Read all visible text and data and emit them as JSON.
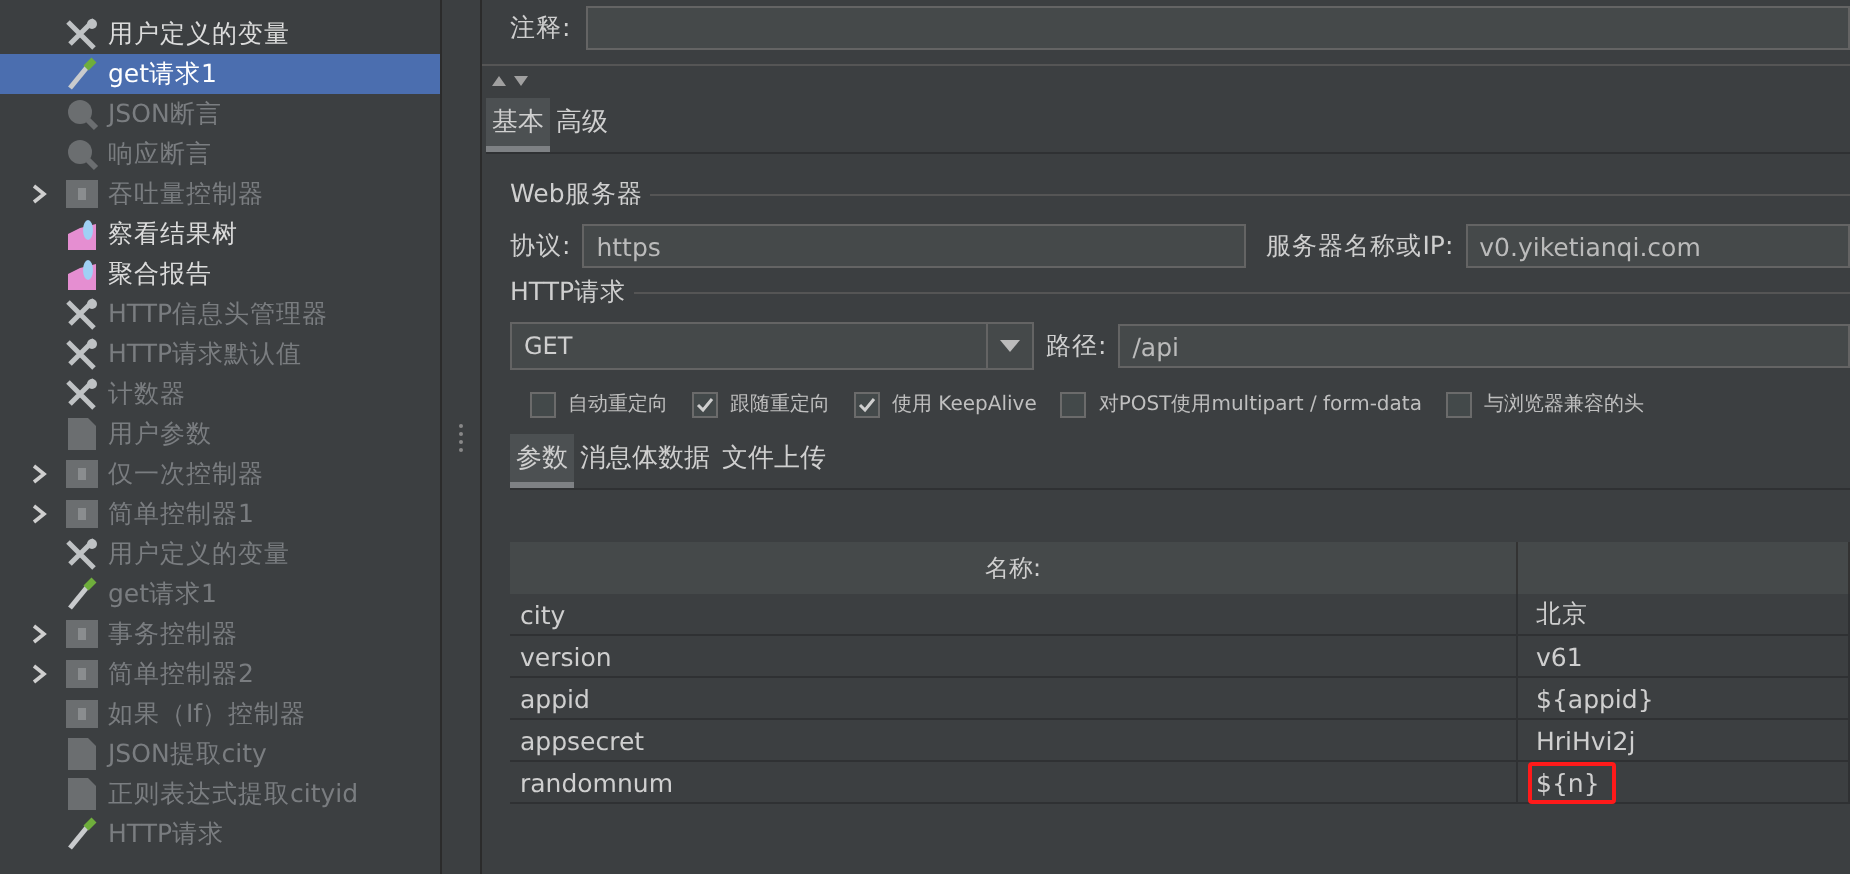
{
  "tree": {
    "items": [
      {
        "label": "用户定义的变量",
        "kind": "wrench",
        "has_children": false,
        "enabled": true,
        "selected": false
      },
      {
        "label": "get请求1",
        "kind": "pipette",
        "has_children": false,
        "enabled": true,
        "selected": true
      },
      {
        "label": "JSON断言",
        "kind": "magnifier",
        "has_children": false,
        "enabled": false,
        "selected": false
      },
      {
        "label": "响应断言",
        "kind": "magnifier",
        "has_children": false,
        "enabled": false,
        "selected": false
      },
      {
        "label": "吞吐量控制器",
        "kind": "controller",
        "has_children": true,
        "enabled": false,
        "selected": false
      },
      {
        "label": "察看结果树",
        "kind": "graph",
        "has_children": false,
        "enabled": true,
        "selected": false
      },
      {
        "label": "聚合报告",
        "kind": "graph",
        "has_children": false,
        "enabled": true,
        "selected": false
      },
      {
        "label": "HTTP信息头管理器",
        "kind": "wrench",
        "has_children": false,
        "enabled": false,
        "selected": false
      },
      {
        "label": "HTTP请求默认值",
        "kind": "wrench",
        "has_children": false,
        "enabled": false,
        "selected": false
      },
      {
        "label": "计数器",
        "kind": "wrench",
        "has_children": false,
        "enabled": false,
        "selected": false
      },
      {
        "label": "用户参数",
        "kind": "page",
        "has_children": false,
        "enabled": false,
        "selected": false
      },
      {
        "label": "仅一次控制器",
        "kind": "controller",
        "has_children": true,
        "enabled": false,
        "selected": false
      },
      {
        "label": "简单控制器1",
        "kind": "controller",
        "has_children": true,
        "enabled": false,
        "selected": false
      },
      {
        "label": "用户定义的变量",
        "kind": "wrench",
        "has_children": false,
        "enabled": false,
        "selected": false
      },
      {
        "label": "get请求1",
        "kind": "pipette",
        "has_children": false,
        "enabled": false,
        "selected": false
      },
      {
        "label": "事务控制器",
        "kind": "controller",
        "has_children": true,
        "enabled": false,
        "selected": false
      },
      {
        "label": "简单控制器2",
        "kind": "controller",
        "has_children": true,
        "enabled": false,
        "selected": false
      },
      {
        "label": "如果（If）控制器",
        "kind": "controller",
        "has_children": false,
        "enabled": false,
        "selected": false
      },
      {
        "label": "JSON提取city",
        "kind": "page",
        "has_children": false,
        "enabled": false,
        "selected": false
      },
      {
        "label": "正则表达式提取cityid",
        "kind": "page",
        "has_children": false,
        "enabled": false,
        "selected": false
      },
      {
        "label": "HTTP请求",
        "kind": "pipette",
        "has_children": false,
        "enabled": false,
        "selected": false
      }
    ]
  },
  "comment": {
    "label": "注释:"
  },
  "tabs": [
    {
      "label": "基本",
      "selected": true
    },
    {
      "label": "高级",
      "selected": false
    }
  ],
  "web_server": {
    "title": "Web服务器",
    "protocol_label": "协议:",
    "protocol": "https",
    "server_label": "服务器名称或IP:",
    "server": "v0.yiketianqi.com"
  },
  "http_request": {
    "title": "HTTP请求",
    "method": "GET",
    "path_label": "路径:",
    "path": "/api",
    "options": [
      {
        "label": "自动重定向",
        "checked": false
      },
      {
        "label": "跟随重定向",
        "checked": true
      },
      {
        "label": "使用 KeepAlive",
        "checked": true
      },
      {
        "label": "对POST使用multipart / form-data",
        "checked": false
      },
      {
        "label": "与浏览器兼容的头",
        "checked": false
      }
    ]
  },
  "sub_tabs": [
    {
      "label": "参数",
      "selected": true
    },
    {
      "label": "消息体数据",
      "selected": false
    },
    {
      "label": "文件上传",
      "selected": false
    }
  ],
  "table": {
    "columns": [
      "名称:"
    ],
    "rows": [
      {
        "name": "city",
        "value": "北京",
        "highlighted": false
      },
      {
        "name": "version",
        "value": "v61",
        "highlighted": false
      },
      {
        "name": "appid",
        "value": "${appid}",
        "highlighted": false
      },
      {
        "name": "appsecret",
        "value": "HriHvi2j",
        "highlighted": false
      },
      {
        "name": "randomnum",
        "value": "${n}",
        "highlighted": true
      }
    ]
  }
}
